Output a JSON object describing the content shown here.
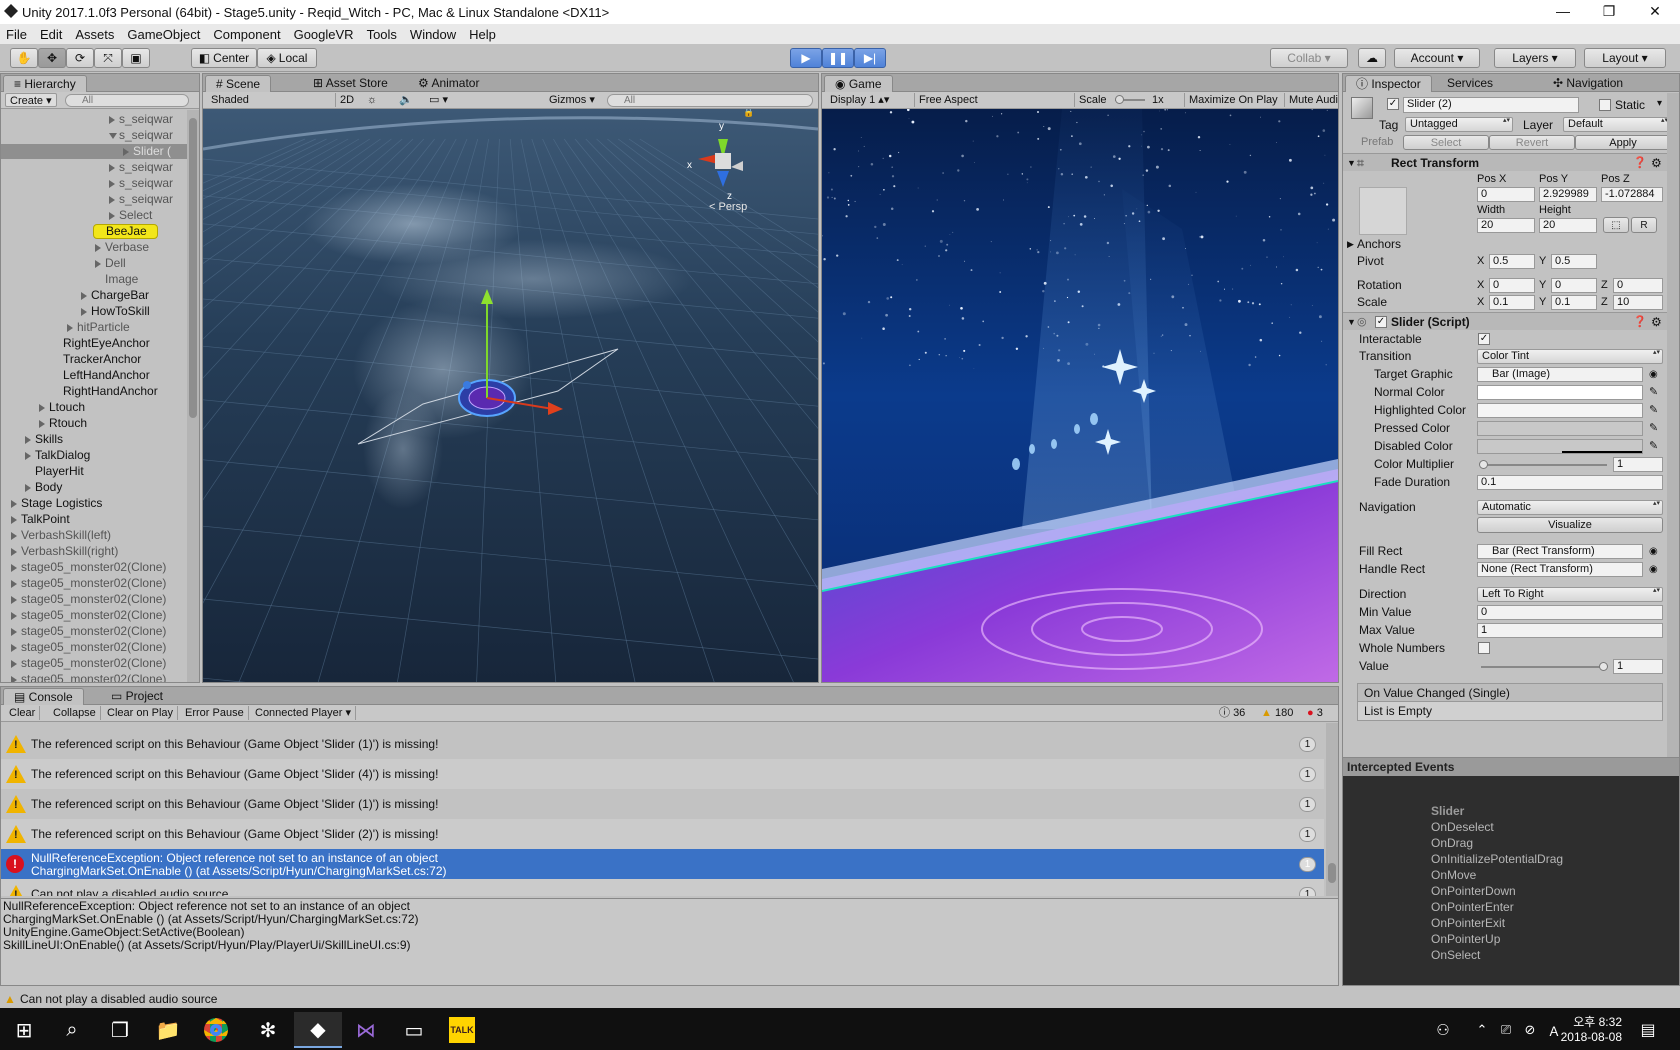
{
  "window": {
    "title": "Unity 2017.1.0f3 Personal (64bit) - Stage5.unity - Reqid_Witch - PC, Mac & Linux Standalone <DX11>",
    "minimize": "—",
    "maximize": "❐",
    "close": "✕"
  },
  "menu": [
    "File",
    "Edit",
    "Assets",
    "GameObject",
    "Component",
    "GoogleVR",
    "Tools",
    "Window",
    "Help"
  ],
  "toolbar": {
    "pivot_label": "Center",
    "space_label": "Local",
    "collab_label": "Collab ▾",
    "account_label": "Account",
    "layers_label": "Layers",
    "layout_label": "Layout"
  },
  "hierarchy": {
    "tab": "Hierarchy",
    "create_label": "Create",
    "search_placeholder": "All",
    "rows": [
      {
        "label": "s_seiqwar",
        "indent": 118,
        "arrow": "right",
        "dim": true
      },
      {
        "label": "s_seiqwar",
        "indent": 118,
        "arrow": "down",
        "dim": true
      },
      {
        "label": "Slider (",
        "indent": 132,
        "arrow": "right",
        "dim": true,
        "selected": true
      },
      {
        "label": "s_seiqwar",
        "indent": 118,
        "arrow": "right",
        "dim": true
      },
      {
        "label": "s_seiqwar",
        "indent": 118,
        "arrow": "right",
        "dim": true
      },
      {
        "label": "s_seiqwar",
        "indent": 118,
        "arrow": "right",
        "dim": true
      },
      {
        "label": "Select",
        "indent": 118,
        "arrow": "right",
        "dim": true
      },
      {
        "label": "BeeJae",
        "indent": 104,
        "arrow": "",
        "dim": false,
        "highlight": true
      },
      {
        "label": "Verbase",
        "indent": 104,
        "arrow": "right",
        "dim": true
      },
      {
        "label": "Dell",
        "indent": 104,
        "arrow": "right",
        "dim": true
      },
      {
        "label": "Image",
        "indent": 104,
        "arrow": "",
        "dim": true
      },
      {
        "label": "ChargeBar",
        "indent": 90,
        "arrow": "right",
        "dim": false
      },
      {
        "label": "HowToSkill",
        "indent": 90,
        "arrow": "right",
        "dim": false
      },
      {
        "label": "hitParticle",
        "indent": 76,
        "arrow": "right",
        "dim": true
      },
      {
        "label": "RightEyeAnchor",
        "indent": 62,
        "arrow": "",
        "dim": false
      },
      {
        "label": "TrackerAnchor",
        "indent": 62,
        "arrow": "",
        "dim": false
      },
      {
        "label": "LeftHandAnchor",
        "indent": 62,
        "arrow": "",
        "dim": false
      },
      {
        "label": "RightHandAnchor",
        "indent": 62,
        "arrow": "",
        "dim": false
      },
      {
        "label": "Ltouch",
        "indent": 48,
        "arrow": "right",
        "dim": false
      },
      {
        "label": "Rtouch",
        "indent": 48,
        "arrow": "right",
        "dim": false
      },
      {
        "label": "Skills",
        "indent": 34,
        "arrow": "right",
        "dim": false
      },
      {
        "label": "TalkDialog",
        "indent": 34,
        "arrow": "right",
        "dim": false
      },
      {
        "label": "PlayerHit",
        "indent": 34,
        "arrow": "",
        "dim": false
      },
      {
        "label": "Body",
        "indent": 34,
        "arrow": "right",
        "dim": false
      },
      {
        "label": "Stage Logistics",
        "indent": 20,
        "arrow": "right",
        "dim": false
      },
      {
        "label": "TalkPoint",
        "indent": 20,
        "arrow": "right",
        "dim": false
      },
      {
        "label": "VerbashSkill(left)",
        "indent": 20,
        "arrow": "right",
        "dim": true
      },
      {
        "label": "VerbashSkill(right)",
        "indent": 20,
        "arrow": "right",
        "dim": true
      },
      {
        "label": "stage05_monster02(Clone)",
        "indent": 20,
        "arrow": "right",
        "dim": true
      },
      {
        "label": "stage05_monster02(Clone)",
        "indent": 20,
        "arrow": "right",
        "dim": true
      },
      {
        "label": "stage05_monster02(Clone)",
        "indent": 20,
        "arrow": "right",
        "dim": true
      },
      {
        "label": "stage05_monster02(Clone)",
        "indent": 20,
        "arrow": "right",
        "dim": true
      },
      {
        "label": "stage05_monster02(Clone)",
        "indent": 20,
        "arrow": "right",
        "dim": true
      },
      {
        "label": "stage05_monster02(Clone)",
        "indent": 20,
        "arrow": "right",
        "dim": true
      },
      {
        "label": "stage05_monster02(Clone)",
        "indent": 20,
        "arrow": "right",
        "dim": true
      },
      {
        "label": "stage05_monster02(Clone)",
        "indent": 20,
        "arrow": "right",
        "dim": true
      }
    ]
  },
  "scene": {
    "tabs": [
      "Scene",
      "Asset Store",
      "Animator"
    ],
    "shading": "Shaded",
    "mode_2d": "2D",
    "gizmos": "Gizmos",
    "search_placeholder": "All",
    "persp": "< Persp",
    "axis_x": "x",
    "axis_y": "y",
    "axis_z": "z"
  },
  "game": {
    "tab": "Game",
    "display": "Display 1",
    "aspect": "Free Aspect",
    "scale_label": "Scale",
    "scale_value": "1x",
    "maximize": "Maximize On Play",
    "mute": "Mute Audio"
  },
  "inspector": {
    "tabs": [
      "Inspector",
      "Services",
      "Navigation"
    ],
    "object_name": "Slider (2)",
    "static_label": "Static",
    "tag_label": "Tag",
    "tag_value": "Untagged",
    "layer_label": "Layer",
    "layer_value": "Default",
    "prefab_label": "Prefab",
    "prefab_select": "Select",
    "prefab_revert": "Revert",
    "prefab_apply": "Apply",
    "rect_transform": {
      "title": "Rect Transform",
      "pos_x_label": "Pos X",
      "pos_y_label": "Pos Y",
      "pos_z_label": "Pos Z",
      "pos_x": "0",
      "pos_y": "2.929989",
      "pos_z": "-1.072884",
      "width_label": "Width",
      "height_label": "Height",
      "width": "20",
      "height": "20",
      "r_button": "R",
      "anchors_label": "Anchors",
      "pivot_label": "Pivot",
      "pivot_x": "0.5",
      "pivot_y": "0.5",
      "rotation_label": "Rotation",
      "rot_x": "0",
      "rot_y": "0",
      "rot_z": "0",
      "scale_label": "Scale",
      "scale_x": "0.1",
      "scale_y": "0.1",
      "scale_z": "10",
      "x": "X",
      "y": "Y",
      "z": "Z"
    },
    "slider": {
      "title": "Slider (Script)",
      "interactable_label": "Interactable",
      "transition_label": "Transition",
      "transition_value": "Color Tint",
      "target_graphic_label": "Target Graphic",
      "target_graphic_value": "Bar (Image)",
      "normal_color_label": "Normal Color",
      "highlighted_color_label": "Highlighted Color",
      "pressed_color_label": "Pressed Color",
      "disabled_color_label": "Disabled Color",
      "color_multiplier_label": "Color Multiplier",
      "color_multiplier_value": "1",
      "fade_duration_label": "Fade Duration",
      "fade_duration_value": "0.1",
      "navigation_label": "Navigation",
      "navigation_value": "Automatic",
      "visualize_label": "Visualize",
      "fill_rect_label": "Fill Rect",
      "fill_rect_value": "Bar (Rect Transform)",
      "handle_rect_label": "Handle Rect",
      "handle_rect_value": "None (Rect Transform)",
      "direction_label": "Direction",
      "direction_value": "Left To Right",
      "min_value_label": "Min Value",
      "min_value": "0",
      "max_value_label": "Max Value",
      "max_value": "1",
      "whole_numbers_label": "Whole Numbers",
      "value_label": "Value",
      "value": "1",
      "on_value_changed": "On Value Changed (Single)",
      "list_empty": "List is Empty"
    },
    "colors": {
      "normal": "#ffffff",
      "highlighted": "#f5f5f5",
      "pressed": "#c8c8c8",
      "disabled": "#c8c8c8"
    }
  },
  "intercepted_events": {
    "title": "Intercepted Events",
    "header": "Slider",
    "items": [
      "OnDeselect",
      "OnDrag",
      "OnInitializePotentialDrag",
      "OnMove",
      "OnPointerDown",
      "OnPointerEnter",
      "OnPointerExit",
      "OnPointerUp",
      "OnSelect"
    ]
  },
  "console": {
    "tabs": [
      "Console",
      "Project"
    ],
    "buttons": [
      "Clear",
      "Collapse",
      "Clear on Play",
      "Error Pause",
      "Connected Player"
    ],
    "info_count": "36",
    "warn_count": "180",
    "error_count": "3",
    "entries": [
      {
        "type": "warn",
        "text": "The referenced script on this Behaviour (Game Object 'Slider (1)') is missing!",
        "count": "1"
      },
      {
        "type": "warn",
        "text": "The referenced script on this Behaviour (Game Object 'Slider (4)') is missing!",
        "count": "1"
      },
      {
        "type": "warn",
        "text": "The referenced script on this Behaviour (Game Object 'Slider (1)') is missing!",
        "count": "1"
      },
      {
        "type": "warn",
        "text": "The referenced script on this Behaviour (Game Object 'Slider (2)') is missing!",
        "count": "1"
      },
      {
        "type": "error",
        "text": "NullReferenceException: Object reference not set to an instance of an object",
        "text2": "ChargingMarkSet.OnEnable () (at Assets/Script/Hyun/ChargingMarkSet.cs:72)",
        "count": "1",
        "selected": true
      },
      {
        "type": "warn",
        "text": "Can not play a disabled audio source",
        "count": "1"
      }
    ],
    "detail": [
      "NullReferenceException: Object reference not set to an instance of an object",
      "ChargingMarkSet.OnEnable () (at Assets/Script/Hyun/ChargingMarkSet.cs:72)",
      "UnityEngine.GameObject:SetActive(Boolean)",
      "SkillLineUI:OnEnable() (at Assets/Script/Hyun/Play/PlayerUi/SkillLineUI.cs:9)"
    ]
  },
  "status_bar": {
    "message": "Can not play a disabled audio source"
  },
  "taskbar": {
    "time": "오후 8:32",
    "date": "2018-08-08"
  }
}
